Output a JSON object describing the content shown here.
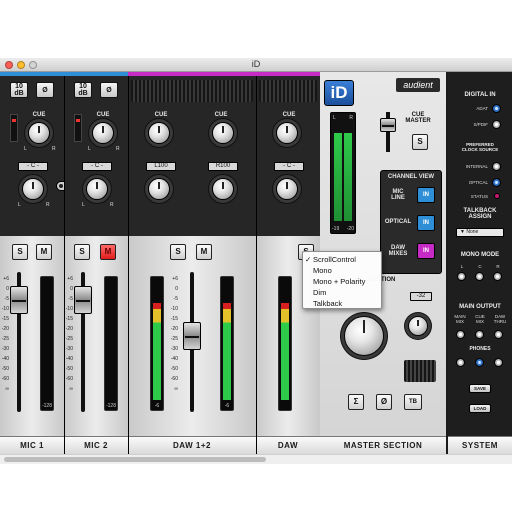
{
  "window": {
    "title": "iD"
  },
  "channels": [
    {
      "name": "MIC 1",
      "top_buttons": [
        "10 dB",
        "Ø"
      ],
      "cue_label": "CUE",
      "pan_label": "- C -",
      "solo": "S",
      "mute": "M",
      "mute_active": false,
      "meter_readout": "-128",
      "accent": "#2f8fd6"
    },
    {
      "name": "MIC 2",
      "top_buttons": [
        "10 dB",
        "Ø"
      ],
      "cue_label": "CUE",
      "pan_label": "- C -",
      "solo": "S",
      "mute": "M",
      "mute_active": true,
      "meter_readout": "-128",
      "accent": "#2f8fd6"
    },
    {
      "name": "DAW 1+2",
      "cue_label": "CUE",
      "pan_labels": [
        "L100",
        "R100"
      ],
      "solo": "S",
      "mute": "M",
      "mute_active": false,
      "meter_readouts": [
        "-6",
        "-6"
      ],
      "accent": "#c62bc6"
    },
    {
      "name": "DAW",
      "cue_label": "CUE",
      "pan_label": "- C -",
      "solo": "S",
      "accent": "#c62bc6"
    }
  ],
  "fader_scale": [
    "+6",
    "0",
    "-5",
    "-10",
    "-15",
    "-20",
    "-25",
    "-30",
    "-40",
    "-50",
    "-60",
    "∞"
  ],
  "dial_lr": {
    "l": "L",
    "r": "R"
  },
  "master": {
    "name": "MASTER SECTION",
    "logo": "iD",
    "brand": "audient",
    "cue_master_label": "CUE\nMASTER",
    "cue_solo": "S",
    "meter_labels": {
      "l": "L",
      "r": "R"
    },
    "meter_readouts": [
      "-19",
      "-20"
    ],
    "channel_view": {
      "title": "CHANNEL VIEW",
      "rows": [
        {
          "label": "MIC\nLINE",
          "button": "IN"
        },
        {
          "label": "OPTICAL",
          "button": "IN"
        },
        {
          "label": "DAW\nMIXES",
          "button": "IN"
        }
      ]
    },
    "section_label": "SECTION",
    "phones_level": "-32",
    "bottom_buttons": [
      "Σ",
      "Ø",
      "TB"
    ]
  },
  "system": {
    "name": "SYSTEM",
    "digital_in": {
      "title": "DIGITAL IN",
      "options": [
        "ADAT",
        "S/PDIF"
      ],
      "selected": "ADAT"
    },
    "clock": {
      "title": "PREFERRED\nCLOCK SOURCE",
      "options": [
        "INTERNAL",
        "OPTICAL"
      ],
      "selected": "OPTICAL",
      "status_label": "STATUS"
    },
    "talkback": {
      "title": "TALKBACK\nASSIGN",
      "value": "None"
    },
    "mono_mode": {
      "title": "MONO MODE",
      "options": [
        "L",
        "C",
        "R"
      ]
    },
    "main_output": {
      "title": "MAIN OUTPUT",
      "options": [
        "MAIN\nMIX",
        "CUE\nMIX",
        "DAW\nTHRU"
      ]
    },
    "phones": {
      "title": "PHONES"
    },
    "save_label": "SAVE",
    "load_label": "LOAD"
  },
  "context_menu": {
    "items": [
      {
        "label": "ScrollControl",
        "checked": true
      },
      {
        "label": "Mono",
        "checked": false
      },
      {
        "label": "Mono + Polarity",
        "checked": false
      },
      {
        "label": "Dim",
        "checked": false
      },
      {
        "label": "Talkback",
        "checked": false
      }
    ]
  },
  "colors": {
    "solo_accent": "#2f8fd6",
    "daw_accent": "#c62bc6",
    "mute_active": "#e01c1c",
    "meter_green": "#2ecb4a"
  }
}
